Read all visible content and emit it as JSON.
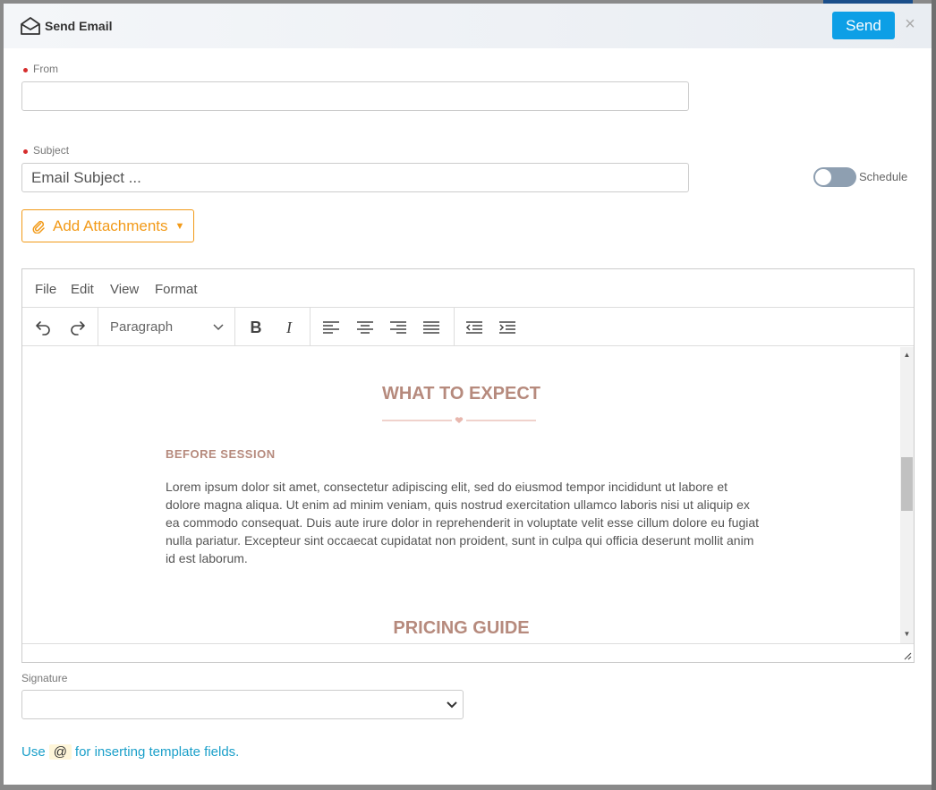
{
  "header": {
    "title": "Send Email",
    "send_label": "Send",
    "close_glyph": "×"
  },
  "from": {
    "label": "From",
    "value": "",
    "placeholder": ""
  },
  "subject": {
    "label": "Subject",
    "value": "",
    "placeholder": "Email Subject ..."
  },
  "schedule": {
    "label": "Schedule",
    "enabled": false
  },
  "attachments": {
    "label": "Add Attachments"
  },
  "editor": {
    "menu": [
      "File",
      "Edit",
      "View",
      "Format"
    ],
    "block_format": "Paragraph",
    "content": {
      "heading1": "WHAT TO EXPECT",
      "subheading": "BEFORE SESSION",
      "paragraph": "Lorem ipsum dolor sit amet, consectetur adipiscing elit, sed do eiusmod tempor incididunt ut labore et dolore magna aliqua. Ut enim ad minim veniam, quis nostrud exercitation ullamco laboris nisi ut aliquip ex ea commodo consequat. Duis aute irure dolor in reprehenderit in voluptate velit esse cillum dolore eu fugiat nulla pariatur. Excepteur sint occaecat cupidatat non proident, sunt in culpa qui officia deserunt mollit anim id est laborum.",
      "heading2": "PRICING GUIDE"
    }
  },
  "signature": {
    "label": "Signature",
    "value": ""
  },
  "hint": {
    "prefix": "Use",
    "token": "@",
    "suffix": "for inserting template fields."
  },
  "colors": {
    "send": "#0d9fe6",
    "attach": "#f29a18",
    "heading": "#b68a7d",
    "link": "#1a9fc9",
    "required": "#d62c2c"
  },
  "icons": {
    "title": "envelope-open-icon",
    "close": "close-icon",
    "attach": "paperclip-icon",
    "undo": "undo-icon",
    "redo": "redo-icon",
    "bold": "bold-icon",
    "italic": "italic-icon",
    "align_left": "align-left-icon",
    "align_center": "align-center-icon",
    "align_right": "align-right-icon",
    "align_justify": "align-justify-icon",
    "outdent": "outdent-icon",
    "indent": "indent-icon"
  }
}
